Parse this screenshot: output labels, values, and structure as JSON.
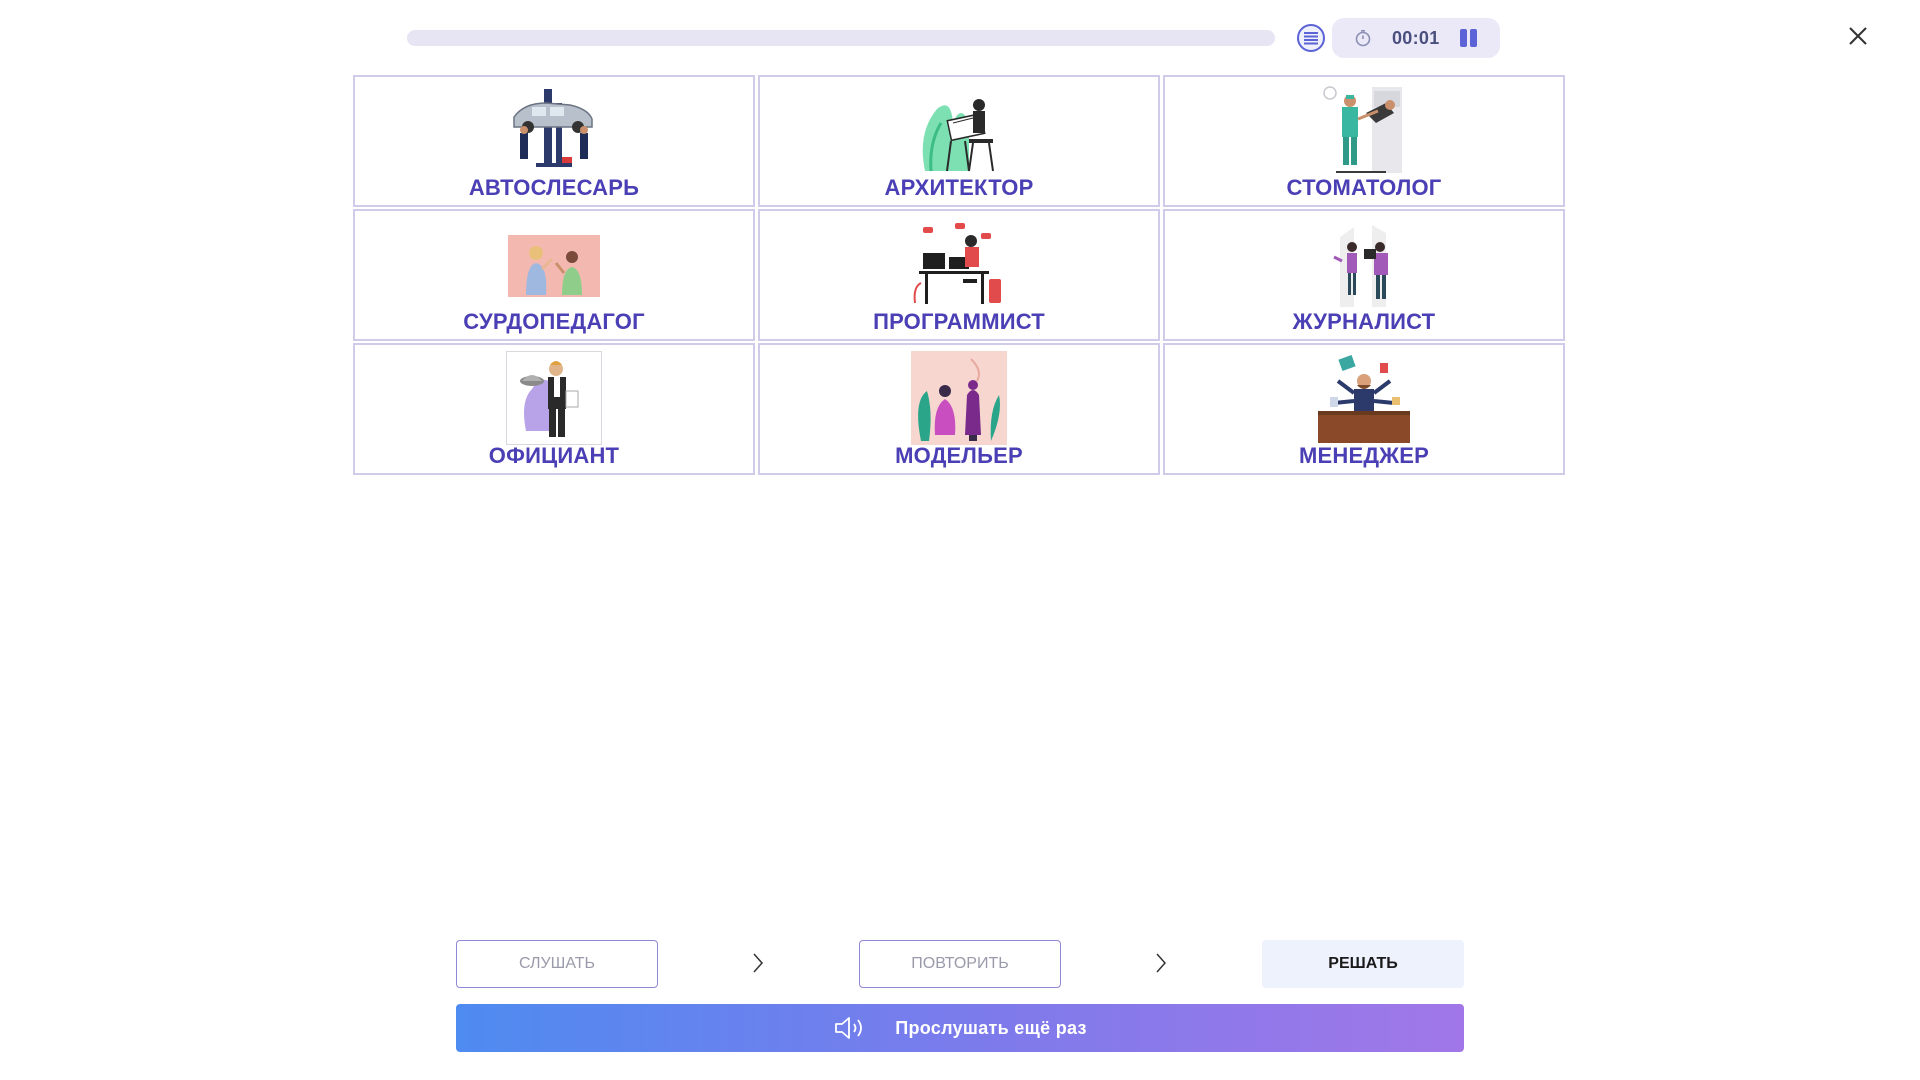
{
  "header": {
    "progress": 0,
    "timer": "00:01",
    "icons": {
      "menu": "list-icon",
      "timer": "stopwatch-icon",
      "pause": "pause-icon",
      "close": "close-icon"
    },
    "colors": {
      "accent": "#5b63d6",
      "label": "#4b3fb5",
      "border": "#cfcbe8"
    }
  },
  "cards": [
    {
      "label": "АВТОСЛЕСАРЬ",
      "image": "car-mechanic-illustration"
    },
    {
      "label": "АРХИТЕКТОР",
      "image": "architect-illustration"
    },
    {
      "label": "СТОМАТОЛОГ",
      "image": "dentist-illustration"
    },
    {
      "label": "СУРДОПЕДАГОГ",
      "image": "sign-language-teacher-illustration"
    },
    {
      "label": "ПРОГРАММИСТ",
      "image": "programmer-illustration"
    },
    {
      "label": "ЖУРНАЛИСТ",
      "image": "journalist-illustration"
    },
    {
      "label": "ОФИЦИАНТ",
      "image": "waiter-illustration"
    },
    {
      "label": "МОДЕЛЬЕР",
      "image": "fashion-designer-illustration"
    },
    {
      "label": "МЕНЕДЖЕР",
      "image": "manager-illustration"
    }
  ],
  "steps": [
    {
      "label": "СЛУШАТЬ"
    },
    {
      "label": "ПОВТОРИТЬ"
    },
    {
      "label": "РЕШАТЬ"
    }
  ],
  "replay": {
    "label": "Прослушать ещё раз",
    "icon": "speaker-icon"
  }
}
